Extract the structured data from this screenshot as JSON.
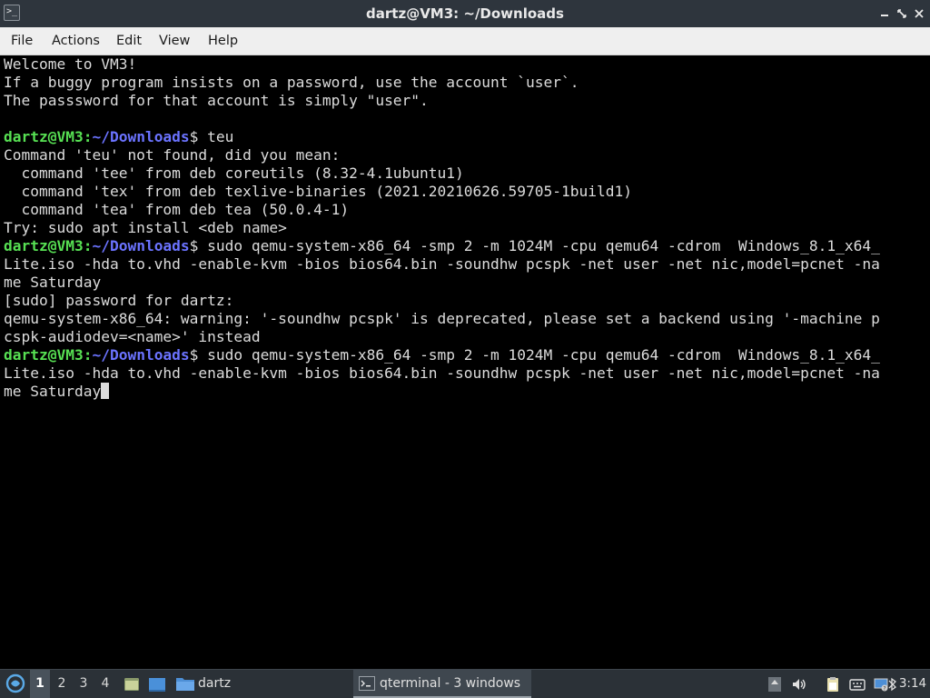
{
  "window": {
    "title": "dartz@VM3: ~/Downloads",
    "icon": "terminal-app-icon",
    "controls": [
      "minimize-icon",
      "maximize-icon",
      "close-icon"
    ]
  },
  "menubar": {
    "items": [
      {
        "label": "File"
      },
      {
        "label": "Actions"
      },
      {
        "label": "Edit"
      },
      {
        "label": "View"
      },
      {
        "label": "Help"
      }
    ]
  },
  "terminal": {
    "colors": {
      "foreground": "#dcdcdc",
      "background": "#000000",
      "prompt_user": "#57e053",
      "prompt_path": "#6b73ff"
    },
    "lines": [
      {
        "text": "Welcome to VM3!"
      },
      {
        "text": "If a buggy program insists on a password, use the account `user`."
      },
      {
        "text": "The passsword for that account is simply \"user\"."
      },
      {
        "text": ""
      },
      {
        "user": "dartz@VM3",
        "sep": ":",
        "path": "~/Downloads",
        "dollar": "$",
        "text": " teu"
      },
      {
        "text": "Command 'teu' not found, did you mean:"
      },
      {
        "text": "  command 'tee' from deb coreutils (8.32-4.1ubuntu1)"
      },
      {
        "text": "  command 'tex' from deb texlive-binaries (2021.20210626.59705-1build1)"
      },
      {
        "text": "  command 'tea' from deb tea (50.0.4-1)"
      },
      {
        "text": "Try: sudo apt install <deb name>"
      },
      {
        "user": "dartz@VM3",
        "sep": ":",
        "path": "~/Downloads",
        "dollar": "$",
        "text": " sudo qemu-system-x86_64 -smp 2 -m 1024M -cpu qemu64 -cdrom  Windows_8.1_x64_"
      },
      {
        "text": "Lite.iso -hda to.vhd -enable-kvm -bios bios64.bin -soundhw pcspk -net user -net nic,model=pcnet -na"
      },
      {
        "text": "me Saturday"
      },
      {
        "text": "[sudo] password for dartz:"
      },
      {
        "text": "qemu-system-x86_64: warning: '-soundhw pcspk' is deprecated, please set a backend using '-machine p"
      },
      {
        "text": "cspk-audiodev=<name>' instead"
      },
      {
        "user": "dartz@VM3",
        "sep": ":",
        "path": "~/Downloads",
        "dollar": "$",
        "text": " sudo qemu-system-x86_64 -smp 2 -m 1024M -cpu qemu64 -cdrom  Windows_8.1_x64_"
      },
      {
        "text": "Lite.iso -hda to.vhd -enable-kvm -bios bios64.bin -soundhw pcspk -net user -net nic,model=pcnet -na"
      },
      {
        "text": "me Saturday",
        "cursor": true
      }
    ]
  },
  "taskbar": {
    "start_icon": "lxqt-start-icon",
    "workspaces": [
      {
        "label": "1",
        "active": true
      },
      {
        "label": "2"
      },
      {
        "label": "3"
      },
      {
        "label": "4"
      }
    ],
    "quicklaunch": [
      "file-manager-icon",
      "show-desktop-icon"
    ],
    "folder_task": {
      "icon": "folder-icon",
      "label": "dartz"
    },
    "active_task": {
      "icon": "terminal-icon",
      "label": "qterminal - 3 windows"
    },
    "tray": [
      "upload-arrow-icon",
      "volume-icon",
      "clipboard-icon",
      "keyboard-icon",
      "network-icon",
      "bluetooth-icon"
    ],
    "clock": "3:14"
  }
}
